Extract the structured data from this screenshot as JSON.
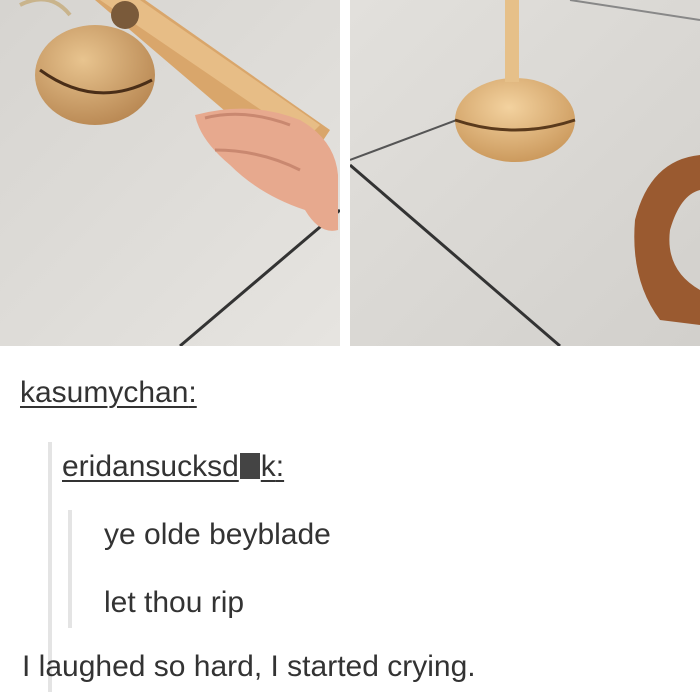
{
  "images": {
    "left": "spinning-top-launch-photo",
    "right": "spinning-top-spinning-photo"
  },
  "post": {
    "op_username": "kasumychan",
    "reply_username_start": "eridansucksd",
    "reply_username_end": "k",
    "quote_lines": [
      "ye olde beyblade",
      "let thou rip"
    ],
    "comment": "I laughed so hard, I started crying."
  },
  "colors": {
    "text": "#333333",
    "quote_bar": "#e4e4e4",
    "tile": "#dcdad6"
  }
}
